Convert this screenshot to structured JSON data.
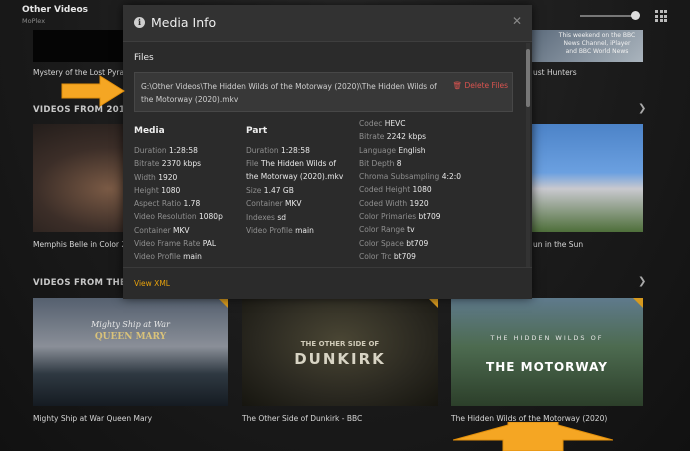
{
  "app": {
    "title": "Other Videos",
    "subtitle": "MoPlex"
  },
  "background": {
    "row1": {
      "captions": [
        "Mystery of the Lost Pyrami",
        "ust Hunters"
      ],
      "news_text": "This weekend on the BBC News Channel, iPlayer and BBC World News"
    },
    "section_2019": {
      "title": "VIDEOS FROM 2019",
      "captions": [
        "Memphis Belle in Color 2",
        "un in the Sun"
      ]
    },
    "section_2020": {
      "title": "VIDEOS FROM THE 202",
      "items": [
        {
          "caption": "Mighty Ship at War Queen Mary",
          "poster_text": "Mighty Ship at War",
          "poster_sub": "QUEEN MARY"
        },
        {
          "caption": "The Other Side of Dunkirk - BBC",
          "poster_text": "THE OTHER SIDE OF",
          "poster_sub": "DUNKIRK"
        },
        {
          "caption": "The Hidden Wilds of the Motorway (2020)",
          "poster_text": "THE HIDDEN WILDS OF",
          "poster_sub": "THE MOTORWAY"
        }
      ]
    }
  },
  "modal": {
    "title": "Media Info",
    "files_label": "Files",
    "file_path": "G:\\Other Videos\\The Hidden Wilds of the Motorway (2020)\\The Hidden Wilds of the Motorway (2020).mkv",
    "delete_label": "Delete Files",
    "media": {
      "heading": "Media",
      "rows": [
        {
          "k": "Duration",
          "v": "1:28:58"
        },
        {
          "k": "Bitrate",
          "v": "2370 kbps"
        },
        {
          "k": "Width",
          "v": "1920"
        },
        {
          "k": "Height",
          "v": "1080"
        },
        {
          "k": "Aspect Ratio",
          "v": "1.78"
        },
        {
          "k": "Video Resolution",
          "v": "1080p"
        },
        {
          "k": "Container",
          "v": "MKV"
        },
        {
          "k": "Video Frame Rate",
          "v": "PAL"
        },
        {
          "k": "Video Profile",
          "v": "main"
        }
      ]
    },
    "part": {
      "heading": "Part",
      "duration": {
        "k": "Duration",
        "v": "1:28:58"
      },
      "file": {
        "k": "File",
        "v": "The Hidden Wilds of the Motorway (2020).mkv"
      },
      "rows": [
        {
          "k": "Size",
          "v": "1.47 GB"
        },
        {
          "k": "Container",
          "v": "MKV"
        },
        {
          "k": "Indexes",
          "v": "sd"
        },
        {
          "k": "Video Profile",
          "v": "main"
        }
      ]
    },
    "codec": {
      "rows": [
        {
          "k": "Codec",
          "v": "HEVC"
        },
        {
          "k": "Bitrate",
          "v": "2242 kbps"
        },
        {
          "k": "Language",
          "v": "English"
        },
        {
          "k": "Bit Depth",
          "v": "8"
        },
        {
          "k": "Chroma Subsampling",
          "v": "4:2:0"
        },
        {
          "k": "Coded Height",
          "v": "1080"
        },
        {
          "k": "Coded Width",
          "v": "1920"
        },
        {
          "k": "Color Primaries",
          "v": "bt709"
        },
        {
          "k": "Color Range",
          "v": "tv"
        },
        {
          "k": "Color Space",
          "v": "bt709"
        },
        {
          "k": "Color Trc",
          "v": "bt709"
        }
      ]
    },
    "footer_link": "View XML"
  },
  "colors": {
    "accent": "#e5a00d",
    "danger": "#d9534f",
    "annotation_arrow": "#f5a623"
  }
}
